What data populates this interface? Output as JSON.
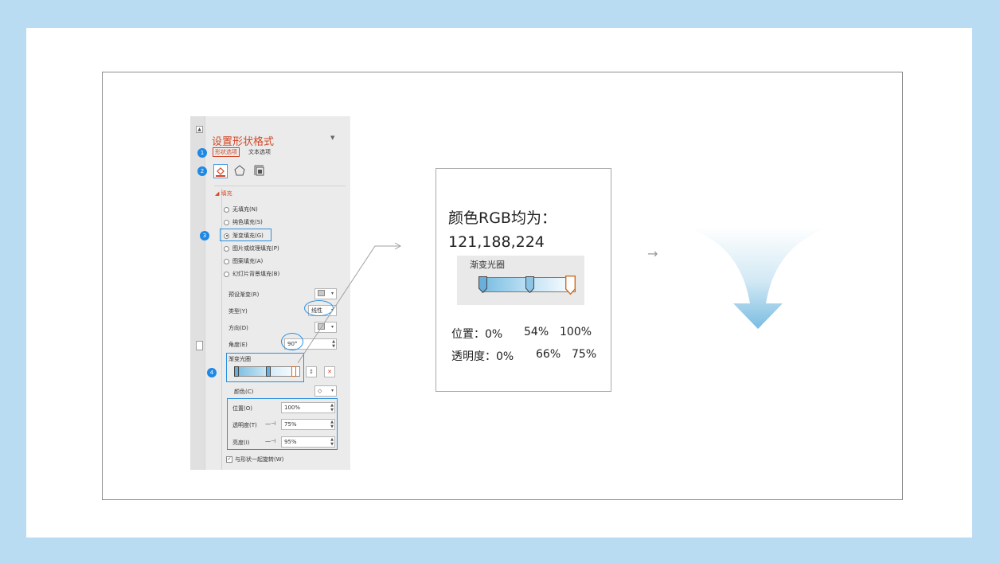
{
  "pane": {
    "title": "设置形状格式",
    "tabs": {
      "shape": "形状选项",
      "text": "文本选项"
    },
    "section": "填充",
    "fill_options": [
      "无填充(N)",
      "纯色填充(S)",
      "渐变填充(G)",
      "图片或纹理填充(P)",
      "图案填充(A)",
      "幻灯片背景填充(B)"
    ],
    "selected_fill": "渐变填充(G)",
    "preset_label": "预设渐变(R)",
    "type_label": "类型(Y)",
    "type_value": "线性",
    "direction_label": "方向(D)",
    "angle_label": "角度(E)",
    "angle_value": "90°",
    "stops_label": "渐变光圈",
    "color_label": "颜色(C)",
    "position_label": "位置(O)",
    "position_value": "100%",
    "transparency_label": "透明度(T)",
    "transparency_value": "75%",
    "brightness_label": "亮度(I)",
    "brightness_value": "95%",
    "rotate_label": "与形状一起旋转(W)",
    "badges": [
      "1",
      "2",
      "3",
      "4"
    ]
  },
  "card": {
    "heading_line1": "颜色RGB均为：",
    "heading_line2": "121,188,224",
    "stops_title": "渐变光圈",
    "position_row": {
      "label": "位置：0%",
      "v2": "54%",
      "v3": "100%"
    },
    "transparency_row": {
      "label": "透明度：0%",
      "v2": "66%",
      "v3": "75%"
    }
  },
  "colors": {
    "background": "#b9dcf3",
    "accent_red": "#d24726",
    "highlight_blue": "#2b8fe0",
    "gradient_blue": "#79bce0"
  }
}
